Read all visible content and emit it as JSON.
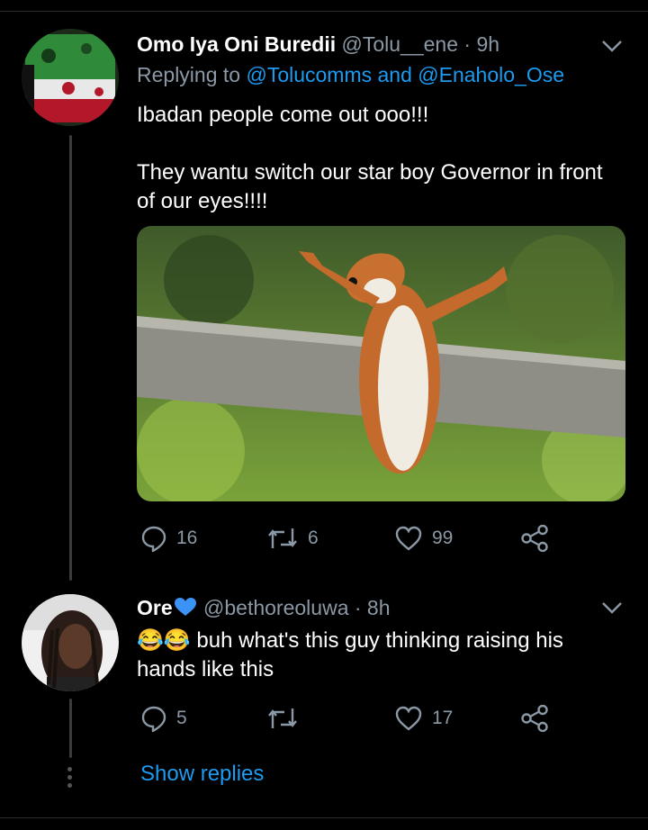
{
  "tweet1": {
    "name": "Omo Iya Oni Buredii",
    "handle": "@Tolu__ene",
    "time": "· 9h",
    "replying_prefix": "Replying to ",
    "replying_users": "@Tolucomms and @Enaholo_Ose",
    "text_line1": "Ibadan people come out ooo!!!",
    "text_line2": "They wantu switch our star boy Governor in front",
    "text_line3": "of our eyes!!!!",
    "replies": "16",
    "retweets": "6",
    "likes": "99"
  },
  "tweet2": {
    "name": "Ore",
    "handle": "@bethoreoluwa",
    "time": "· 8h",
    "emoji": "😂😂",
    "text_line1": " buh what's this guy thinking raising his",
    "text_line2": "hands like this",
    "replies": "5",
    "retweets": "",
    "likes": "17"
  },
  "show_replies": "Show replies",
  "colors": {
    "accent": "#1d9bf0",
    "muted": "#8b98a5",
    "background": "#000000"
  },
  "icons": [
    "reply-icon",
    "retweet-icon",
    "like-icon",
    "share-icon",
    "chevron-down-icon",
    "verified-heart-icon"
  ]
}
